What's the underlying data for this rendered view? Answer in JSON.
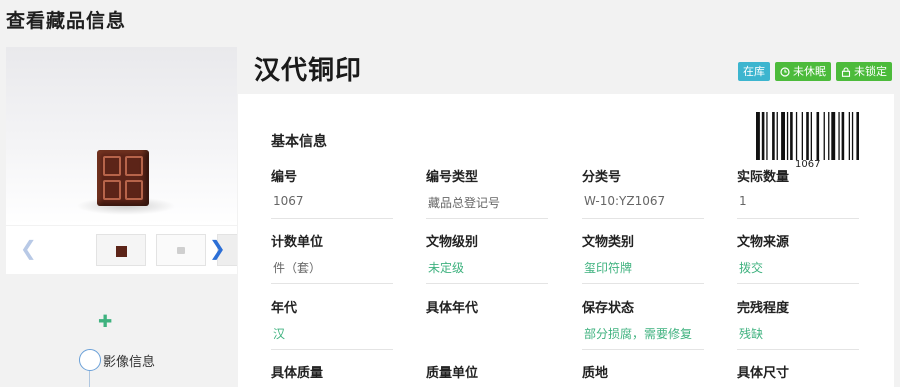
{
  "page": {
    "title": "查看藏品信息"
  },
  "gallery": {
    "prev_icon": "chevron-left-icon",
    "next_icon": "chevron-right-icon"
  },
  "sidebar": {
    "add_icon": "plus-icon",
    "timeline_label": "影像信息"
  },
  "item": {
    "title": "汉代铜印",
    "badges": [
      {
        "label": "在库",
        "color": "#3db5cf"
      },
      {
        "label": "未休眠",
        "icon": "clock-icon",
        "color": "#4cbb3b"
      },
      {
        "label": "未锁定",
        "icon": "lock-icon",
        "color": "#4cbb3b"
      }
    ],
    "barcode": "1067"
  },
  "basic_info": {
    "section_title": "基本信息",
    "fields": [
      {
        "label": "编号",
        "value": "1067"
      },
      {
        "label": "编号类型",
        "value": "藏品总登记号"
      },
      {
        "label": "分类号",
        "value": "W-10:YZ1067"
      },
      {
        "label": "实际数量",
        "value": "1"
      },
      {
        "label": "计数单位",
        "value": "件（套）"
      },
      {
        "label": "文物级别",
        "value": "未定级",
        "link": true
      },
      {
        "label": "文物类别",
        "value": "玺印符牌",
        "link": true
      },
      {
        "label": "文物来源",
        "value": "拨交",
        "link": true
      },
      {
        "label": "年代",
        "value": "汉",
        "link": true
      },
      {
        "label": "具体年代",
        "value": ""
      },
      {
        "label": "保存状态",
        "value": "部分损腐，需要修复",
        "link": true
      },
      {
        "label": "完残程度",
        "value": "残缺",
        "link": true
      },
      {
        "label": "具体质量",
        "value": ""
      },
      {
        "label": "质量单位",
        "value": ""
      },
      {
        "label": "质地",
        "value": ""
      },
      {
        "label": "具体尺寸",
        "value": ""
      }
    ]
  },
  "colors": {
    "accent_green": "#3fb27f",
    "badge_blue": "#3db5cf",
    "badge_green": "#4cbb3b",
    "nav_blue": "#2c6fd6"
  }
}
